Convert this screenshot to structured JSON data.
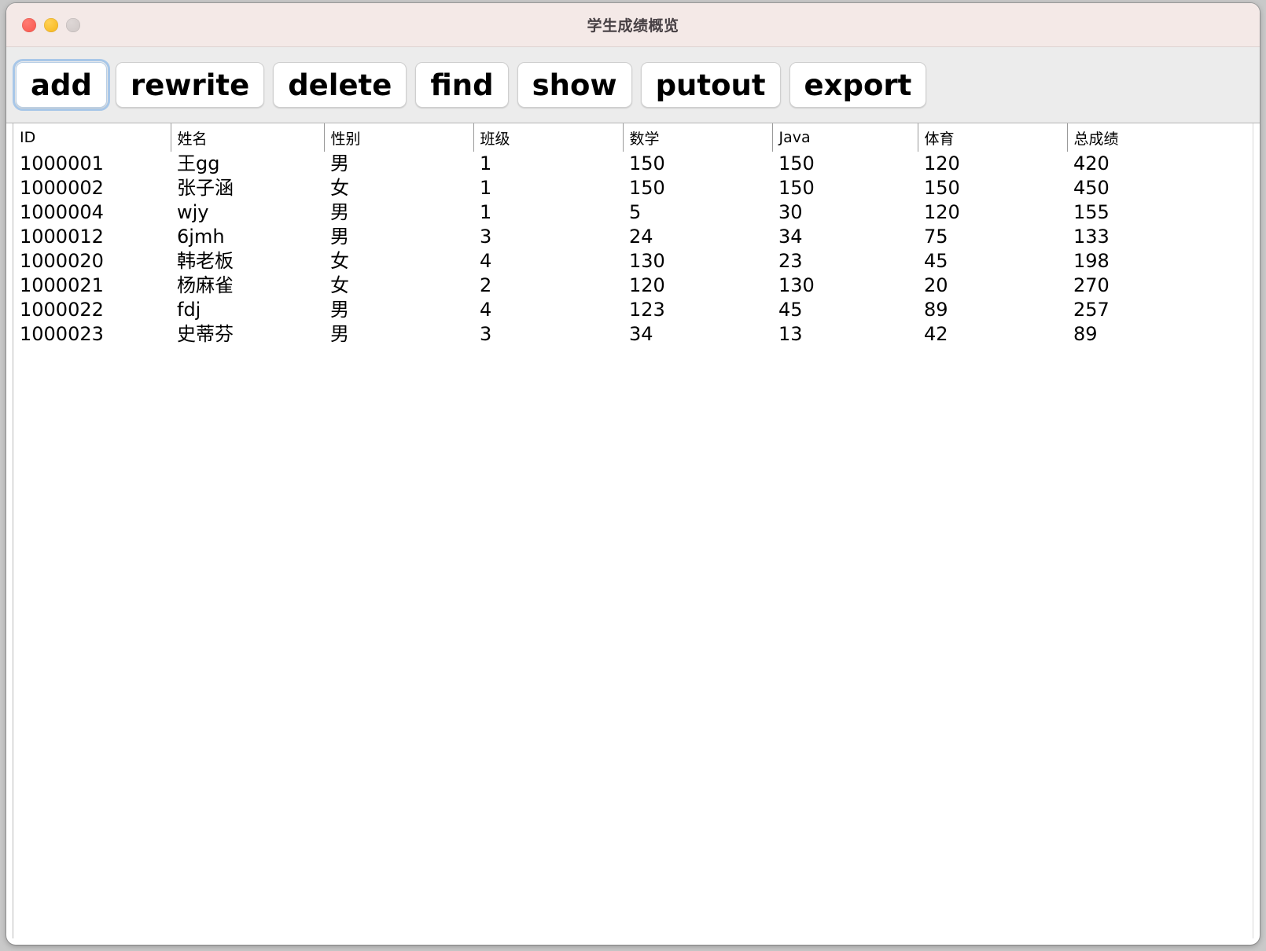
{
  "window": {
    "title": "学生成绩概览",
    "traffic_lights": [
      {
        "name": "close",
        "color": "#f9544b"
      },
      {
        "name": "minimize",
        "color": "#f6b418"
      },
      {
        "name": "zoom",
        "color": "#cfc7c6"
      }
    ],
    "titlebar_color": "#f4e9e7",
    "toolbar_color": "#ececec"
  },
  "toolbar": {
    "buttons": [
      {
        "label": "add",
        "focused": true
      },
      {
        "label": "rewrite",
        "focused": false
      },
      {
        "label": "delete",
        "focused": false
      },
      {
        "label": "find",
        "focused": false
      },
      {
        "label": "show",
        "focused": false
      },
      {
        "label": "putout",
        "focused": false
      },
      {
        "label": "export",
        "focused": false
      }
    ],
    "focus_ring_color": "#a8c7e8"
  },
  "table": {
    "columns": [
      "ID",
      "姓名",
      "性别",
      "班级",
      "数学",
      "Java",
      "体育",
      "总成绩"
    ],
    "rows": [
      [
        "1000001",
        "王gg",
        "男",
        "1",
        "150",
        "150",
        "120",
        "420"
      ],
      [
        "1000002",
        "张子涵",
        "女",
        "1",
        "150",
        "150",
        "150",
        "450"
      ],
      [
        "1000004",
        "wjy",
        "男",
        "1",
        "5",
        "30",
        "120",
        "155"
      ],
      [
        "1000012",
        "6jmh",
        "男",
        "3",
        "24",
        "34",
        "75",
        "133"
      ],
      [
        "1000020",
        "韩老板",
        "女",
        "4",
        "130",
        "23",
        "45",
        "198"
      ],
      [
        "1000021",
        "杨麻雀",
        "女",
        "2",
        "120",
        "130",
        "20",
        "270"
      ],
      [
        "1000022",
        "fdj",
        "男",
        "4",
        "123",
        "45",
        "89",
        "257"
      ],
      [
        "1000023",
        "史蒂芬",
        "男",
        "3",
        "34",
        "13",
        "42",
        "89"
      ]
    ]
  }
}
